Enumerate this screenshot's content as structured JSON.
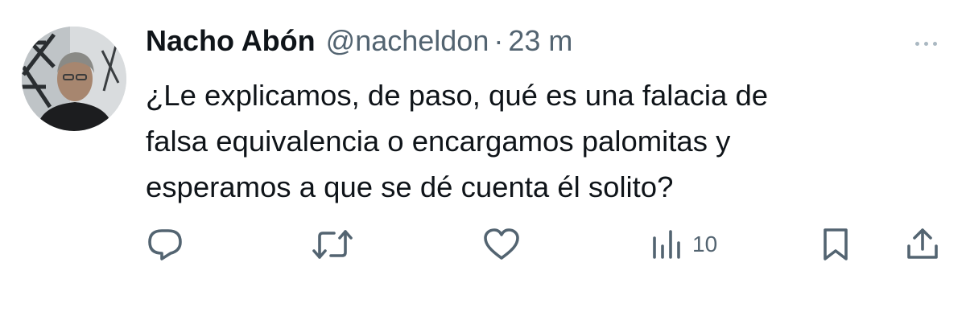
{
  "tweet": {
    "author_name": "Nacho Abón",
    "handle": "@nacheldon",
    "separator": "·",
    "time": "23 m",
    "text_lines": [
      "¿Le explicamos, de paso, qué es una falacia de",
      "falsa equivalencia o encargamos palomitas y",
      "esperamos a que se dé cuenta él solito?"
    ]
  },
  "actions": {
    "reply": {
      "icon": "reply-icon"
    },
    "retweet": {
      "icon": "retweet-icon"
    },
    "like": {
      "icon": "heart-icon"
    },
    "views": {
      "icon": "views-bar-chart-icon",
      "count": "10"
    },
    "bookmark": {
      "icon": "bookmark-icon"
    },
    "share": {
      "icon": "share-icon"
    }
  },
  "colors": {
    "text": "#0f1419",
    "secondary": "#536471",
    "icon": "#536471"
  }
}
